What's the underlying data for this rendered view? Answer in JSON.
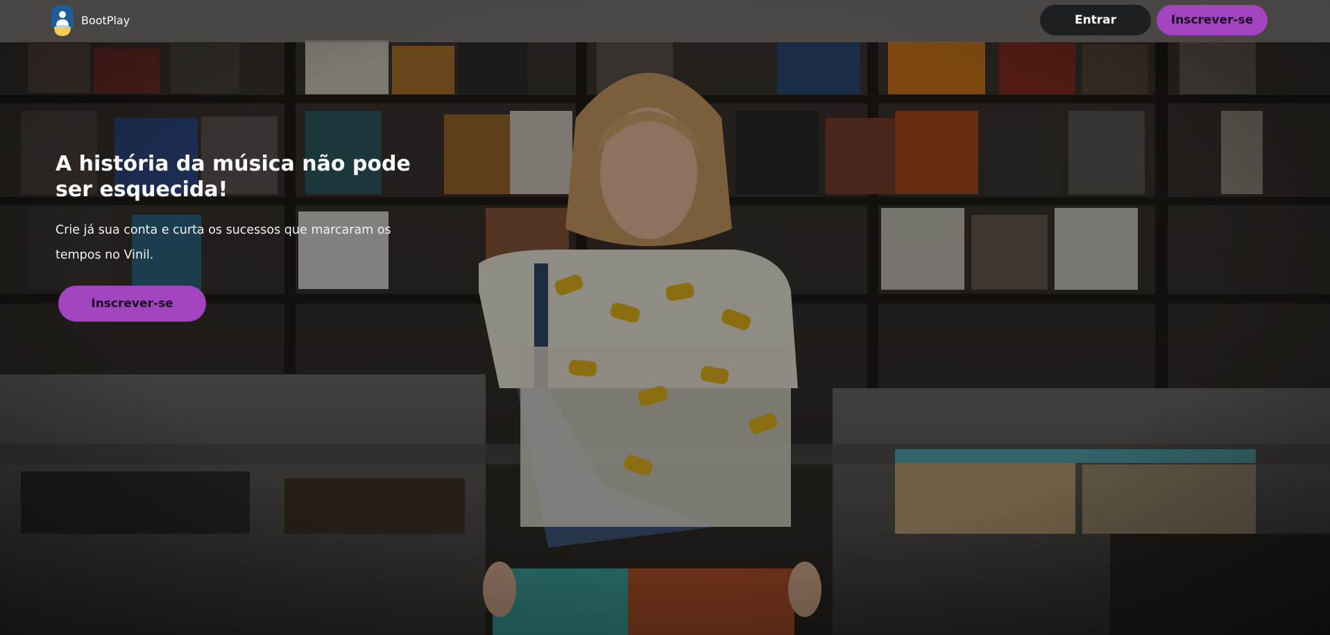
{
  "navbar": {
    "brand_name": "BootPlay",
    "login_label": "Entrar",
    "signup_label": "Inscrever-se"
  },
  "hero": {
    "title": "A história da música não pode ser esquecida!",
    "subtitle": "Crie já sua conta e curta os sucessos que marcaram os tempos no Vinil.",
    "cta_label": "Inscrever-se"
  },
  "icons": {
    "logo": "bootplay-logo-icon"
  },
  "colors": {
    "accent": "#a243bf",
    "login_button": "#1d1f21",
    "navbar_overlay": "#5a5856",
    "logo_blue": "#1f5d99",
    "logo_yellow": "#f3cd5a"
  }
}
